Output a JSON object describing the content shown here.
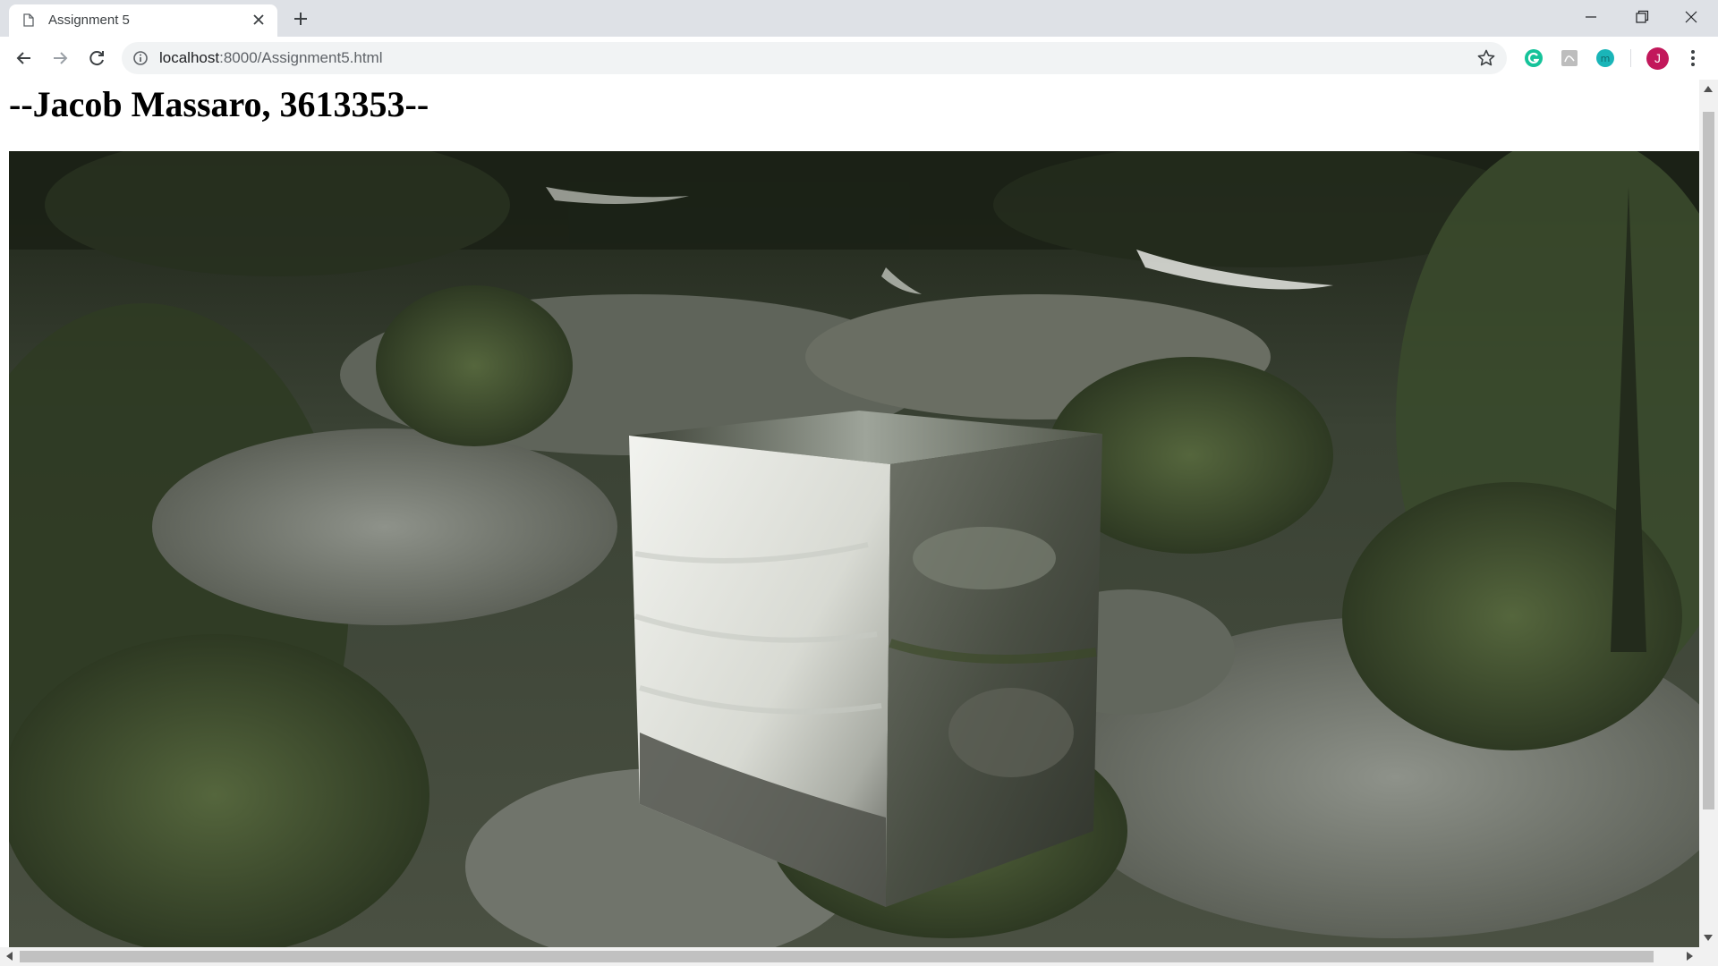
{
  "browser": {
    "tab": {
      "title": "Assignment 5"
    },
    "address_bar": {
      "host": "localhost",
      "path": ":8000/Assignment5.html"
    },
    "profile": {
      "initial": "J",
      "color": "#c2185b"
    },
    "extensions": [
      "grammarly-icon",
      "pdf-icon",
      "meet-icon"
    ]
  },
  "page": {
    "heading": "--Jacob Massaro, 3613353--",
    "scene": {
      "description_icon": "skybox-cubemap-scene"
    }
  },
  "colors": {
    "grammarly": "#15c39a",
    "teal_ext": "#1ab5b8",
    "tabstrip": "#dee1e6"
  }
}
